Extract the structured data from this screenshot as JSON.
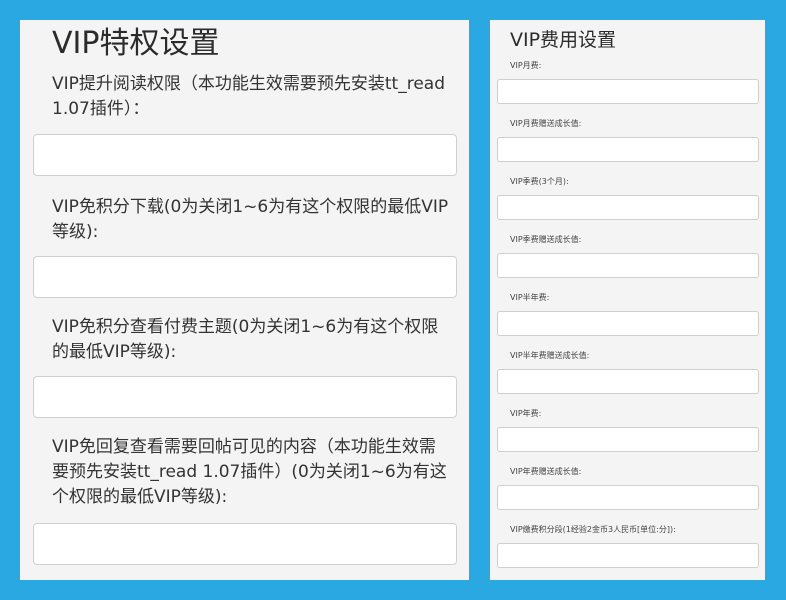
{
  "left": {
    "title": "VIP特权设置",
    "fields": [
      {
        "label": "VIP提升阅读权限（本功能生效需要预先安装tt_read 1.07插件）：",
        "value": ""
      },
      {
        "label": "VIP免积分下载(0为关闭1~6为有这个权限的最低VIP等级):",
        "value": ""
      },
      {
        "label": "VIP免积分查看付费主题(0为关闭1~6为有这个权限的最低VIP等级):",
        "value": ""
      },
      {
        "label": "VIP免回复查看需要回帖可见的内容（本功能生效需要预先安装tt_read 1.07插件）(0为关闭1~6为有这个权限的最低VIP等级):",
        "value": ""
      }
    ]
  },
  "right": {
    "title": "VIP费用设置",
    "fields": [
      {
        "label": "VIP月费:",
        "value": ""
      },
      {
        "label": "VIP月费赠送成长值:",
        "value": ""
      },
      {
        "label": "VIP季费(3个月):",
        "value": ""
      },
      {
        "label": "VIP季费赠送成长值:",
        "value": ""
      },
      {
        "label": "VIP半年费:",
        "value": ""
      },
      {
        "label": "VIP半年费赠送成长值:",
        "value": ""
      },
      {
        "label": "VIP年费:",
        "value": ""
      },
      {
        "label": "VIP年费赠送成长值:",
        "value": ""
      },
      {
        "label": "VIP缴费积分段(1经验2金币3人民币[单位:分]):",
        "value": ""
      }
    ]
  }
}
